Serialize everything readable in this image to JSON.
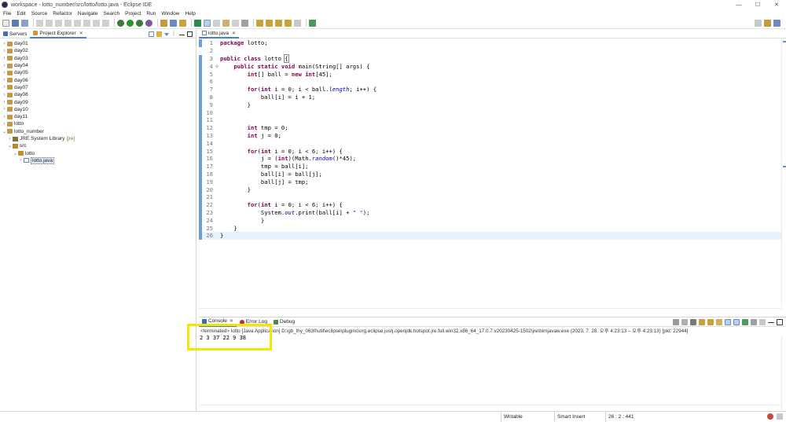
{
  "window": {
    "title": "workspace - lotto_number/src/lotto/lotto.java - Eclipse IDE",
    "minimize": "—",
    "maximize": "☐",
    "close": "✕"
  },
  "menu": [
    "File",
    "Edit",
    "Source",
    "Refactor",
    "Navigate",
    "Search",
    "Project",
    "Run",
    "Window",
    "Help"
  ],
  "left_panel": {
    "tabs": [
      {
        "label": "Servers",
        "active": false
      },
      {
        "label": "Project Explorer",
        "active": true
      }
    ],
    "tree": [
      {
        "label": "day01",
        "level": 0,
        "expanded": false,
        "icon": "project-icon"
      },
      {
        "label": "day02",
        "level": 0,
        "expanded": false,
        "icon": "project-icon"
      },
      {
        "label": "day03",
        "level": 0,
        "expanded": false,
        "icon": "project-icon"
      },
      {
        "label": "day04",
        "level": 0,
        "expanded": false,
        "icon": "project-icon"
      },
      {
        "label": "day05",
        "level": 0,
        "expanded": false,
        "icon": "project-icon"
      },
      {
        "label": "day06",
        "level": 0,
        "expanded": false,
        "icon": "project-icon"
      },
      {
        "label": "day07",
        "level": 0,
        "expanded": false,
        "icon": "project-icon"
      },
      {
        "label": "day08",
        "level": 0,
        "expanded": false,
        "icon": "project-icon"
      },
      {
        "label": "day09",
        "level": 0,
        "expanded": false,
        "icon": "project-icon"
      },
      {
        "label": "day10",
        "level": 0,
        "expanded": false,
        "icon": "project-icon"
      },
      {
        "label": "day11",
        "level": 0,
        "expanded": false,
        "icon": "project-icon"
      },
      {
        "label": "lotto",
        "level": 0,
        "expanded": false,
        "icon": "project-icon"
      },
      {
        "label": "lotto_number",
        "level": 0,
        "expanded": true,
        "icon": "project-icon"
      },
      {
        "label": "JRE System Library",
        "decor": "[jre]",
        "level": 1,
        "expanded": false,
        "icon": "library-icon"
      },
      {
        "label": "src",
        "level": 1,
        "expanded": true,
        "icon": "source-folder-icon"
      },
      {
        "label": "lotto",
        "level": 2,
        "expanded": true,
        "icon": "package-icon"
      },
      {
        "label": "lotto.java",
        "level": 3,
        "expanded": false,
        "icon": "java-file-icon",
        "selected": true
      }
    ]
  },
  "editor": {
    "tab_label": "lotto.java",
    "lines": [
      {
        "n": "1",
        "fold": "",
        "mod": true,
        "html": "<span class='kw'>package</span> lotto;"
      },
      {
        "n": "2",
        "fold": "",
        "mod": false,
        "html": ""
      },
      {
        "n": "3",
        "fold": "",
        "mod": true,
        "html": "<span class='kw'>public</span> <span class='kw'>class</span> lotto <span style='outline:1px solid #888'>{</span>"
      },
      {
        "n": "4",
        "fold": "⊖",
        "mod": true,
        "html": "    <span class='kw'>public</span> <span class='kw'>static</span> <span class='kw'>void</span> main(String[] args) {"
      },
      {
        "n": "5",
        "fold": "",
        "mod": true,
        "html": "        <span class='kw'>int</span>[] ball = <span class='kw'>new</span> <span class='kw'>int</span>[45];"
      },
      {
        "n": "6",
        "fold": "",
        "mod": true,
        "html": ""
      },
      {
        "n": "7",
        "fold": "",
        "mod": true,
        "html": "        <span class='kw'>for</span>(<span class='kw'>int</span> i = 0; i &lt; ball.<span class='fld'>length</span>; i++) {"
      },
      {
        "n": "8",
        "fold": "",
        "mod": true,
        "html": "            ball[i] = i + 1;"
      },
      {
        "n": "9",
        "fold": "",
        "mod": true,
        "html": "        }"
      },
      {
        "n": "10",
        "fold": "",
        "mod": true,
        "html": ""
      },
      {
        "n": "11",
        "fold": "",
        "mod": true,
        "html": ""
      },
      {
        "n": "12",
        "fold": "",
        "mod": true,
        "html": "        <span class='kw'>int</span> tmp = 0;"
      },
      {
        "n": "13",
        "fold": "",
        "mod": true,
        "html": "        <span class='kw'>int</span> j = 0;"
      },
      {
        "n": "14",
        "fold": "",
        "mod": true,
        "html": ""
      },
      {
        "n": "15",
        "fold": "",
        "mod": true,
        "html": "        <span class='kw'>for</span>(<span class='kw'>int</span> i = 0; i &lt; 6; i++) {"
      },
      {
        "n": "16",
        "fold": "",
        "mod": true,
        "html": "            j = (<span class='kw'>int</span>)(Math.<span class='fld'>random</span>()*45);"
      },
      {
        "n": "17",
        "fold": "",
        "mod": true,
        "html": "            tmp = ball[i];"
      },
      {
        "n": "18",
        "fold": "",
        "mod": true,
        "html": "            ball[i] = ball[j];"
      },
      {
        "n": "19",
        "fold": "",
        "mod": true,
        "html": "            ball[j] = tmp;"
      },
      {
        "n": "20",
        "fold": "",
        "mod": true,
        "html": "        }"
      },
      {
        "n": "21",
        "fold": "",
        "mod": true,
        "html": ""
      },
      {
        "n": "22",
        "fold": "",
        "mod": true,
        "html": "        <span class='kw'>for</span>(<span class='kw'>int</span> i = 0; i &lt; 6; i++) {"
      },
      {
        "n": "23",
        "fold": "",
        "mod": true,
        "html": "            System.<span class='fld'>out</span>.print(ball[i] + <span class='str'>\" \"</span>);"
      },
      {
        "n": "24",
        "fold": "",
        "mod": true,
        "html": "            }"
      },
      {
        "n": "25",
        "fold": "",
        "mod": true,
        "html": "    }"
      },
      {
        "n": "26",
        "fold": "",
        "mod": true,
        "html": "}",
        "current": true
      }
    ]
  },
  "console": {
    "tabs": [
      {
        "label": "Console",
        "active": true,
        "color": "#3a6fb5"
      },
      {
        "label": "Error Log",
        "active": false,
        "color": "#c03030"
      },
      {
        "label": "Debug",
        "active": false,
        "color": "#4a8a3a"
      }
    ],
    "status": "<terminated> lotto [Java Application] D:\\gb_lhy_0630\\util\\eclipse\\plugins\\org.eclipse.justj.openjdk.hotspot.jre.full.win32.x86_64_17.0.7.v20230425-1502\\jre\\bin\\javaw.exe  (2023. 7. 28. 오후 4:23:13 – 오후 4:23:13) [pid: 22944]",
    "output": "2 3 37 22 9 38 "
  },
  "statusbar": {
    "writable": "Writable",
    "insert_mode": "Smart Insert",
    "position": "26 : 2 : 441"
  },
  "colors": {
    "accent": "#4a7fcf",
    "keyword": "#7f0055",
    "highlight_box": "#f4e600",
    "change_marker": "#6b9ed8"
  }
}
